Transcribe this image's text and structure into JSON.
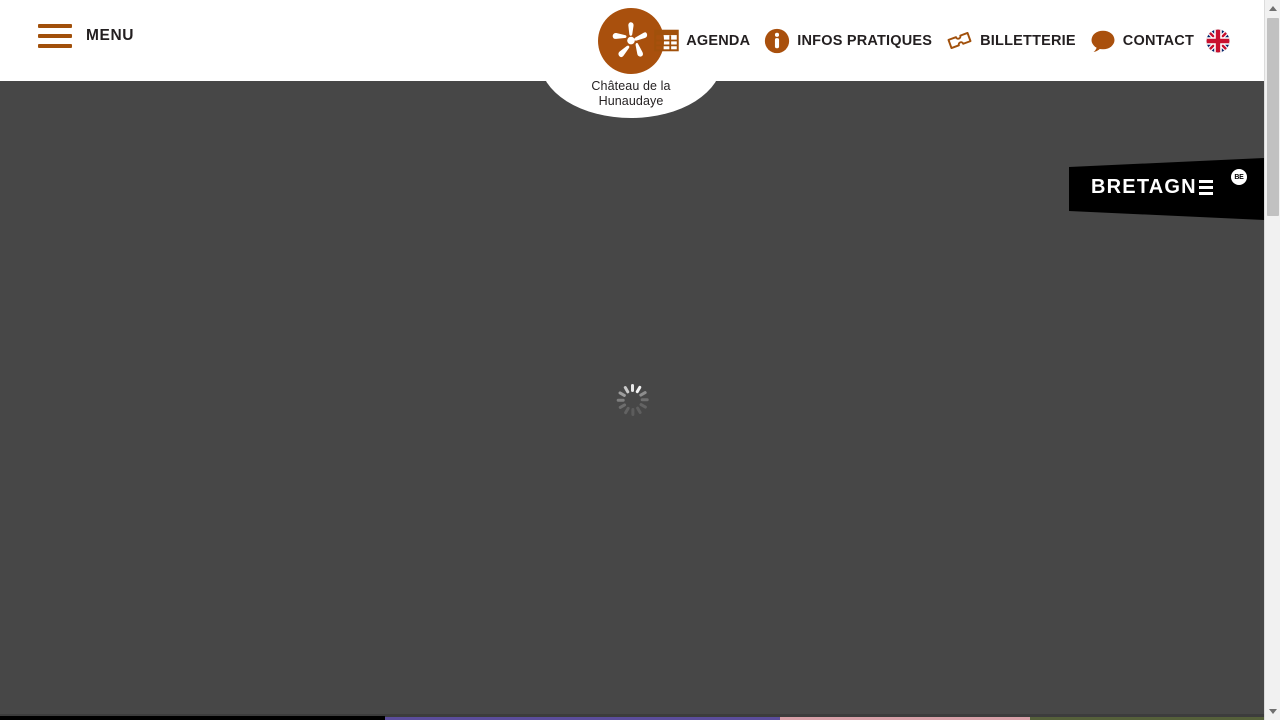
{
  "site": {
    "logo_title_line1": "Château de la",
    "logo_title_line2": "Hunaudaye",
    "logo_icon": "splat-star-icon"
  },
  "header": {
    "menu_label": "MENU",
    "menu_icon": "hamburger-icon",
    "nav": [
      {
        "label": "AGENDA",
        "icon": "calendar-icon"
      },
      {
        "label": "INFOS PRATIQUES",
        "icon": "info-circle-icon"
      },
      {
        "label": "BILLETTERIE",
        "icon": "ticket-icon"
      },
      {
        "label": "CONTACT",
        "icon": "speech-bubble-icon"
      }
    ],
    "language_switch": {
      "icon": "uk-flag-icon",
      "label": "English"
    }
  },
  "badge": {
    "text": "BRETAGNE",
    "mark": "BE",
    "icon": "bretagne-banner-icon"
  },
  "main": {
    "status": "loading",
    "spinner_icon": "loading-spinner-icon"
  },
  "scrollbar": {
    "up_icon": "scroll-up-arrow-icon",
    "down_icon": "scroll-down-arrow-icon",
    "thumb": "scroll-thumb"
  },
  "colors": {
    "brand_orange": "#A9500D",
    "menu_orange": "#A1500B",
    "page_background": "#474747",
    "header_background": "#FFFFFF",
    "badge_background": "#000000",
    "text_dark": "#231F20",
    "spinner": "#BDBDBD"
  }
}
